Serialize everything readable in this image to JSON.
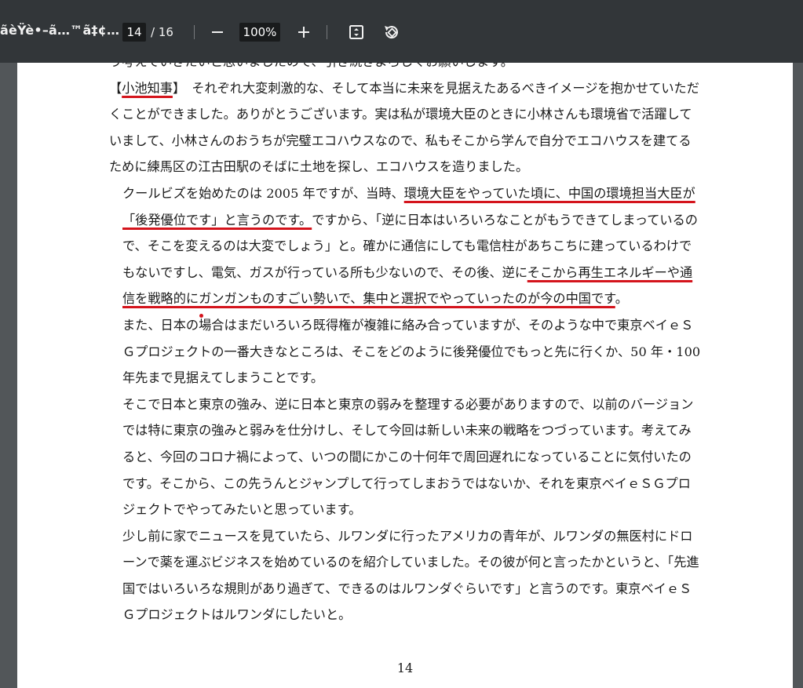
{
  "toolbar": {
    "doc_title": "ãèŸè•–ã…™ã‡¢…",
    "current_page": "14",
    "total_pages": "/ 16",
    "zoom": "100%",
    "zoom_out_icon": "minus-icon",
    "zoom_in_icon": "plus-icon",
    "fit_icon": "fit-page-icon",
    "rotate_icon": "rotate-icon"
  },
  "document": {
    "page_number": "14",
    "top_partial_line": "う考えていきたいと思いましたので、引き続きよろしくお願いします。",
    "para1_bracket_open": "【",
    "para1_speaker": "小池知事",
    "para1_bracket_close": "】",
    "para1_text": "　それぞれ大変刺激的な、そして本当に未来を見据えたあるべきイメージを抱かせていただくことができました。ありがとうございます。実は私が環境大臣のときに小林さんも環境省で活躍していまして、小林さんのおうちが完璧エコハウスなので、私もそこから学んで自分でエコハウスを建てるために練馬区の江古田駅のそばに土地を探し、エコハウスを造りました。",
    "para2_pre": "クールビズを始めたのは 2005 年ですが、当時、",
    "para2_ul1": "環境大臣をやっていた頃に、中国の環境担当大臣が「後発優位です」と言うのです。",
    "para2_mid": "ですから、「逆に日本はいろいろなことがもうできてしまっているので、そこを変えるのは大変でしょう」と。確かに通信にしても電信柱があちこちに建っているわけでもないですし、電気、ガスが行っている所も少ないので、その後、逆に",
    "para2_ul2": "そこから再生エネルギーや通信を戦略的にガンガンものすごい勢いで、集中と選択でやっていったのが今の中国です",
    "para2_post": "。",
    "para3": "また、日本の場合はまだいろいろ既得権が複雑に絡み合っていますが、そのような中で東京ベイｅＳＧプロジェクトの一番大きなところは、そこをどのように後発優位でもっと先に行くか、50 年・100 年先まで見据えてしまうことです。",
    "para4": "そこで日本と東京の強み、逆に日本と東京の弱みを整理する必要がありますので、以前のバージョンでは特に東京の強みと弱みを仕分けし、そして今回は新しい未来の戦略をつづっています。考えてみると、今回のコロナ禍によって、いつの間にかこの十何年で周回遅れになっていることに気付いたのです。そこから、この先うんとジャンプして行ってしまおうではないか、それを東京ベイｅＳＧプロジェクトでやってみたいと思っています。",
    "para5": "少し前に家でニュースを見ていたら、ルワンダに行ったアメリカの青年が、ルワンダの無医村にドローンで薬を運ぶビジネスを始めているのを紹介していました。その彼が何と言ったかというと、「先進国ではいろいろな規則があり過ぎて、できるのはルワンダぐらいです」と言うのです。東京ベイｅＳＧプロジェクトはルワンダにしたいと。"
  },
  "colors": {
    "toolbar_bg": "#323639",
    "viewer_bg": "#525659",
    "annotation_red": "#d4141c"
  }
}
